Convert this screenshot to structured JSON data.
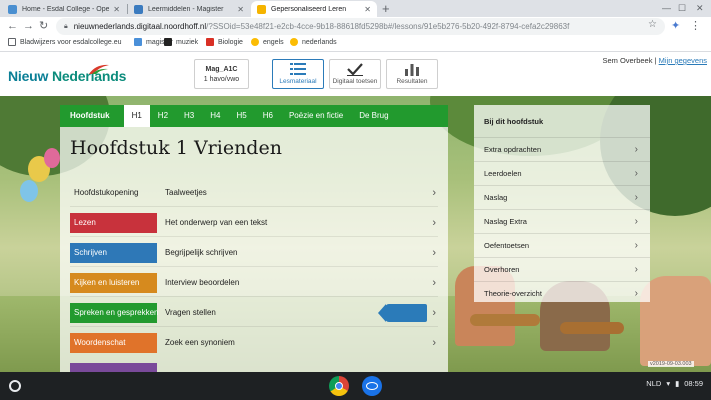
{
  "browser": {
    "tabs": [
      {
        "title": "Home - Esdal College - Openbaar",
        "active": false
      },
      {
        "title": "Leermiddelen - Magister",
        "active": false
      },
      {
        "title": "Gepersonaliseerd Leren",
        "active": true
      }
    ],
    "new_tab": "+",
    "url_host": "nieuwnederlands.digitaal.noordhoff.nl",
    "url_rest": "/?SSOid=53e48f21-e2cb-4cce-9b18-88618fd5298b#/lessons/91e5b276-5b20-492f-8794-cefa2c29863f",
    "bookmarks": [
      {
        "label": "Bladwijzers voor esdalcollege.eu",
        "color": "#5f6368"
      },
      {
        "label": "magister",
        "color": "#4a90d9"
      },
      {
        "label": "muziek",
        "color": "#222222"
      },
      {
        "label": "Biologie",
        "color": "#d93025"
      },
      {
        "label": "engels",
        "color": "#fbbc04"
      },
      {
        "label": "nederlands",
        "color": "#fbbc04"
      }
    ]
  },
  "header": {
    "logo_word1": "Nieuw",
    "logo_word2": "Nederlands",
    "course": {
      "name": "Mag_A1C",
      "level": "1 havo/vwo"
    },
    "nav": [
      {
        "label": "Lesmateriaal",
        "icon": "list-icon",
        "active": true
      },
      {
        "label": "Digitaal toetsen",
        "icon": "checkmark-icon",
        "active": false
      },
      {
        "label": "Resultaten",
        "icon": "bar-chart-icon",
        "active": false
      }
    ],
    "user_name": "Sem Overbeek",
    "user_separator": "|",
    "user_link": "Mijn gegevens"
  },
  "chapter": {
    "tab_label": "Hoofdstuk",
    "tabs": [
      "H1",
      "H2",
      "H3",
      "H4",
      "H5",
      "H6",
      "Poëzie en fictie",
      "De Brug"
    ],
    "active_tab": "H1",
    "title": "Hoofdstuk 1 Vrienden",
    "lessons": [
      {
        "category": "Hoofdstukopening",
        "title": "Taalweetjes",
        "color": ""
      },
      {
        "category": "Lezen",
        "title": "Het onderwerp van een tekst",
        "color": "#c8323c"
      },
      {
        "category": "Schrijven",
        "title": "Begrijpelijk schrijven",
        "color": "#2e78b7"
      },
      {
        "category": "Kijken en luisteren",
        "title": "Interview beoordelen",
        "color": "#d68a1e"
      },
      {
        "category": "Spreken en gesprekken",
        "title": "Vragen stellen",
        "color": "#229a2e"
      },
      {
        "category": "Woordenschat",
        "title": "Zoek een synoniem",
        "color": "#e0732a"
      },
      {
        "category": "",
        "title": "",
        "color": "#7a4a9a"
      }
    ]
  },
  "side": {
    "title": "Bij dit hoofdstuk",
    "items": [
      "Extra opdrachten",
      "Leerdoelen",
      "Naslag",
      "Naslag Extra",
      "Oefentoetsen",
      "Overhoren",
      "Theorie-overzicht"
    ]
  },
  "version": "v2019-09-03.003",
  "shelf": {
    "language": "NLD",
    "time": "08:59"
  }
}
